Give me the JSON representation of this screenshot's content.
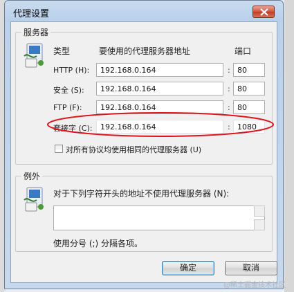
{
  "dialog": {
    "title": "代理设置",
    "servers": {
      "legend": "服务器",
      "col_type": "类型",
      "col_address": "要使用的代理服务器地址",
      "col_port": "端口",
      "rows": [
        {
          "label": "HTTP (H):",
          "address": "192.168.0.164",
          "port": "80"
        },
        {
          "label": "安全 (S):",
          "address": "192.168.0.164",
          "port": "80"
        },
        {
          "label": "FTP (F):",
          "address": "192.168.0.164",
          "port": "80"
        },
        {
          "label": "套接字 (C):",
          "address": "192.168.0.164",
          "port": "1080"
        }
      ],
      "same_proxy_label": "对所有协议均使用相同的代理服务器 (U)"
    },
    "exceptions": {
      "legend": "例外",
      "desc": "对于下列字符开头的地址不使用代理服务器 (N):",
      "value": "",
      "hint": "使用分号 (;) 分隔各项。"
    },
    "ok_label": "确定",
    "cancel_label": "取消"
  },
  "watermark": "@稀土掘金技术社区",
  "colors": {
    "highlight_ellipse": "#e0141e",
    "title_bar": "#b9d1ea"
  }
}
